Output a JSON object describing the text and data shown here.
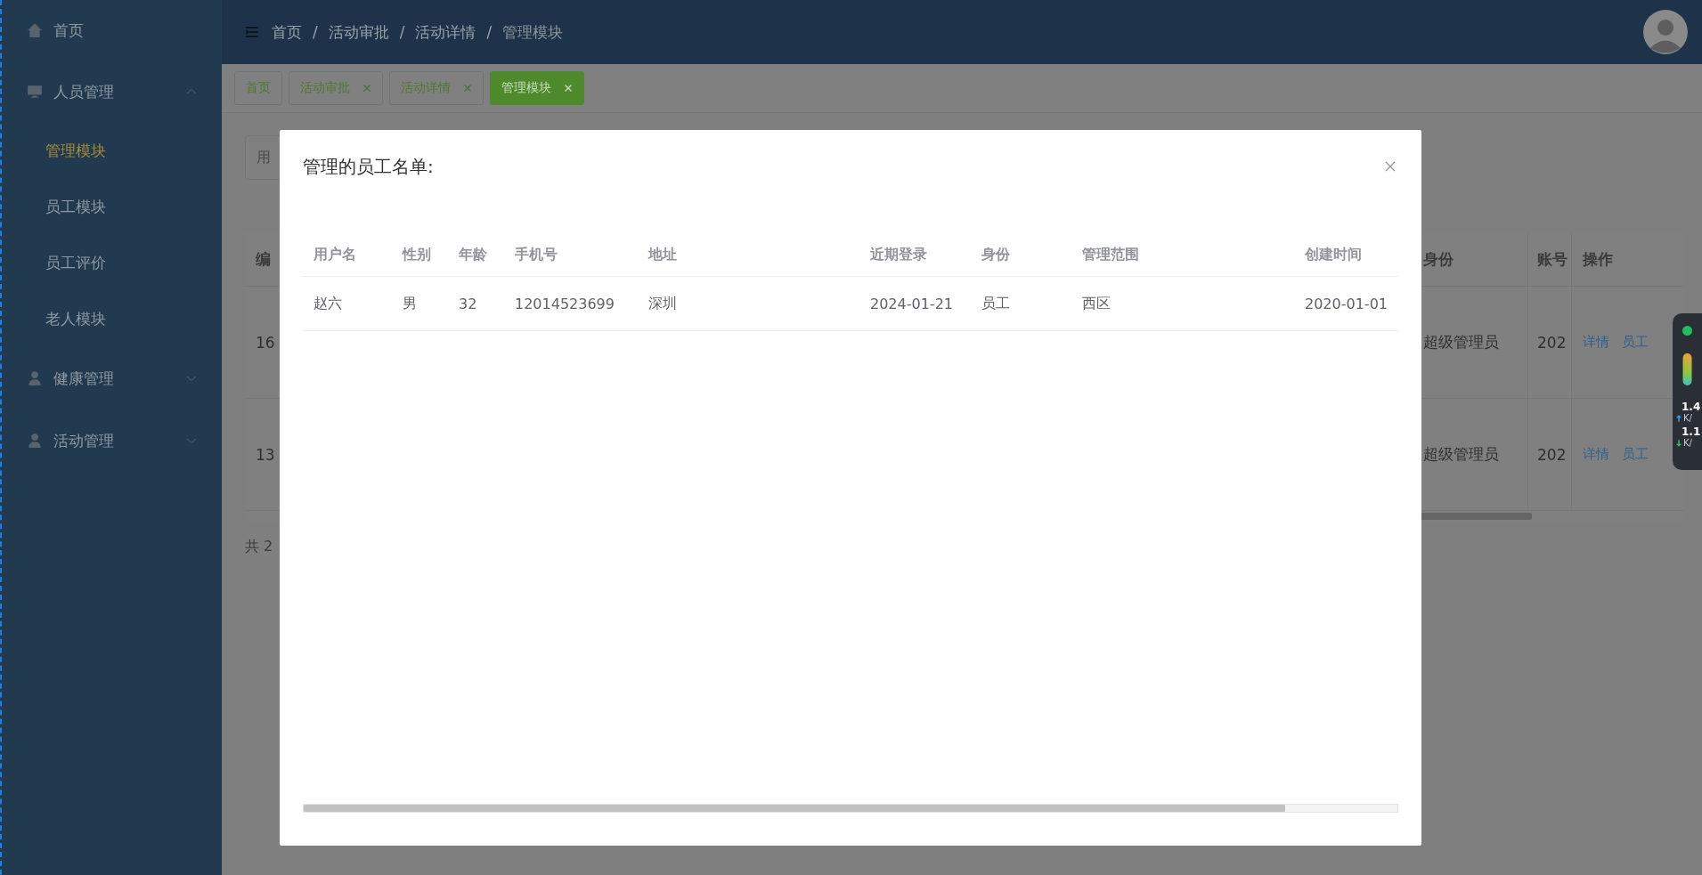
{
  "sidebar": {
    "items": [
      {
        "label": "首页",
        "selected": false
      },
      {
        "label": "人员管理",
        "selected": false,
        "expanded": true,
        "children": [
          {
            "label": "管理模块",
            "selected": true
          },
          {
            "label": "员工模块",
            "selected": false
          },
          {
            "label": "员工评价",
            "selected": false
          },
          {
            "label": "老人模块",
            "selected": false
          }
        ]
      },
      {
        "label": "健康管理",
        "selected": false,
        "expanded": false
      },
      {
        "label": "活动管理",
        "selected": false,
        "expanded": false
      }
    ]
  },
  "header": {
    "breadcrumb": [
      "首页",
      "活动审批",
      "活动详情",
      "管理模块"
    ],
    "separator": "/"
  },
  "tags": [
    {
      "label": "首页",
      "closable": false,
      "selected": false
    },
    {
      "label": "活动审批",
      "closable": true,
      "selected": false
    },
    {
      "label": "活动详情",
      "closable": true,
      "selected": false
    },
    {
      "label": "管理模块",
      "closable": true,
      "selected": true
    }
  ],
  "background": {
    "search": {
      "placeholder": "用"
    },
    "table": {
      "columns": [
        "编",
        "身份",
        "账号",
        "操作"
      ],
      "rows": [
        {
          "id": "16",
          "role": "超级管理员",
          "account": "202",
          "actions": [
            "详情",
            "员工"
          ]
        },
        {
          "id": "13",
          "role": "超级管理员",
          "account": "202",
          "actions": [
            "详情",
            "员工"
          ]
        }
      ]
    },
    "total": "共 2"
  },
  "modal": {
    "title": "管理的员工名单:",
    "columns": [
      "用户名",
      "性别",
      "年龄",
      "手机号",
      "地址",
      "近期登录",
      "身份",
      "管理范围",
      "创建时间"
    ],
    "rows": [
      [
        "赵六",
        "男",
        "32",
        "12014523699",
        "深圳",
        "2024-01-21",
        "员工",
        "西区",
        "2020-01-01"
      ]
    ]
  },
  "monitor": {
    "readings": [
      {
        "value": "1.4",
        "unit": "K/",
        "kind": "up"
      },
      {
        "value": "1.1",
        "unit": "K/",
        "kind": "down"
      }
    ]
  }
}
